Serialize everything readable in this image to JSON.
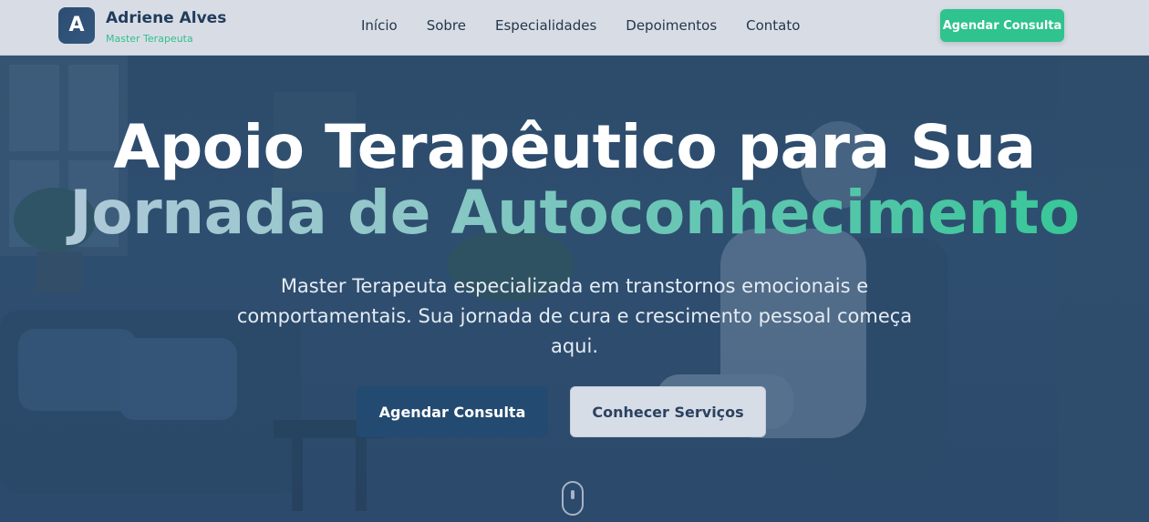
{
  "header": {
    "logo_letter": "A",
    "brand_name": "Adriene Alves",
    "brand_subtitle": "Master Terapeuta",
    "nav": [
      "Início",
      "Sobre",
      "Especialidades",
      "Depoimentos",
      "Contato"
    ],
    "cta_label": "Agendar Consulta"
  },
  "hero": {
    "headline_line1": "Apoio Terapêutico para Sua",
    "headline_line2": "Jornada de Autoconhecimento",
    "subtitle": "Master Terapeuta especializada em transtornos emocionais e comportamentais. Sua jornada de cura e crescimento pessoal começa aqui.",
    "primary_button": "Agendar Consulta",
    "secondary_button": "Conhecer Serviços"
  },
  "colors": {
    "accent": "#2fc38d",
    "brand_dark": "#223d5c",
    "hero_bg": "#2d4c6b",
    "header_bg": "#d8dde5"
  },
  "icons": {
    "logo": "letter-logo",
    "scroll": "mouse-scroll-icon"
  }
}
